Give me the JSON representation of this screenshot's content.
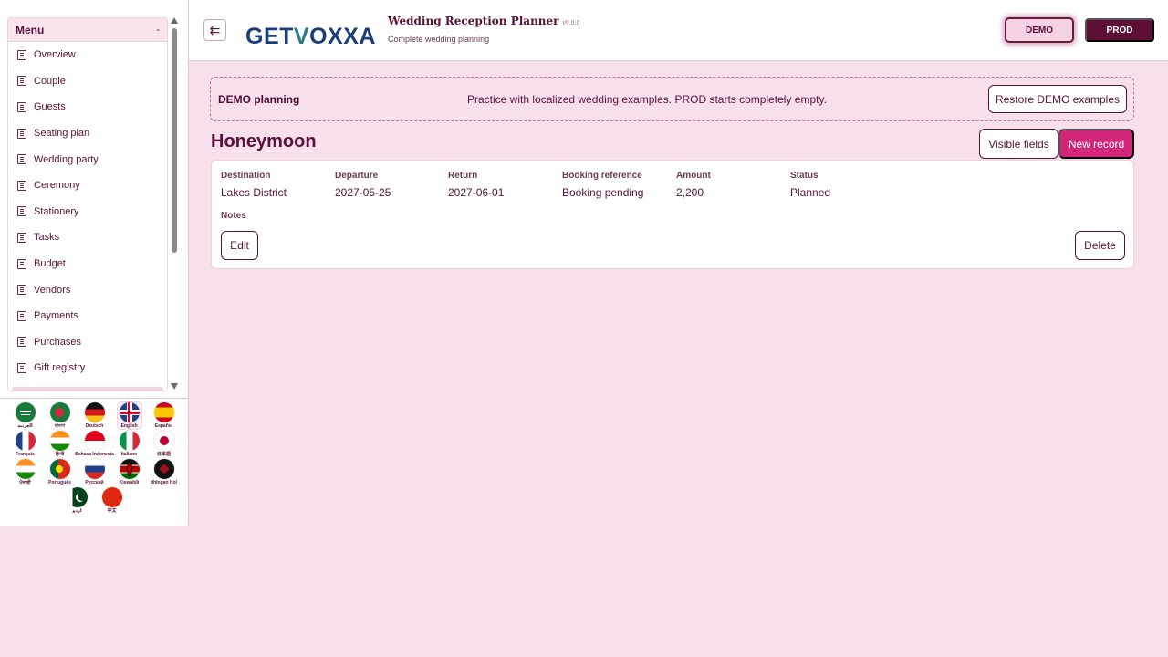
{
  "sidebar": {
    "menu_title": "Menu",
    "collapse_glyph": "-",
    "items": [
      {
        "label": "Overview"
      },
      {
        "label": "Couple"
      },
      {
        "label": "Guests"
      },
      {
        "label": "Seating plan"
      },
      {
        "label": "Wedding party"
      },
      {
        "label": "Ceremony"
      },
      {
        "label": "Stationery"
      },
      {
        "label": "Tasks"
      },
      {
        "label": "Budget"
      },
      {
        "label": "Vendors"
      },
      {
        "label": "Payments"
      },
      {
        "label": "Purchases"
      },
      {
        "label": "Gift registry"
      }
    ],
    "languages": [
      {
        "label": "العربية"
      },
      {
        "label": "বাংলা"
      },
      {
        "label": "Deutsch"
      },
      {
        "label": "English",
        "selected": true
      },
      {
        "label": "Español"
      },
      {
        "label": "Français"
      },
      {
        "label": "हिन्दी"
      },
      {
        "label": "Bahasa Indonesia"
      },
      {
        "label": "Italiano"
      },
      {
        "label": "日本語"
      },
      {
        "label": "ਪੰਜਾਬੀ"
      },
      {
        "label": "Português"
      },
      {
        "label": "Русский"
      },
      {
        "label": "Kiswahili"
      },
      {
        "label": "tlhIngan Hol"
      },
      {
        "label": "اردو"
      },
      {
        "label": "中文"
      }
    ]
  },
  "header": {
    "toggle_glyph": "⇇",
    "logo_get": "GET",
    "logo_v": "V",
    "logo_rest": "OXXA",
    "title": "Wedding Reception Planner",
    "version": "v9.0.0",
    "subtitle": "Complete wedding planning",
    "demo_label": "DEMO",
    "prod_label": "PROD"
  },
  "banner": {
    "title": "DEMO planning",
    "text": "Practice with localized wedding examples. PROD starts completely empty.",
    "restore_label": "Restore DEMO examples"
  },
  "section": {
    "title": "Honeymoon",
    "visible_fields_label": "Visible fields",
    "new_record_label": "New record"
  },
  "record": {
    "fields": [
      {
        "label": "Destination",
        "value": "Lakes District"
      },
      {
        "label": "Departure",
        "value": "2027-05-25"
      },
      {
        "label": "Return",
        "value": "2027-06-01"
      },
      {
        "label": "Booking reference",
        "value": "Booking pending"
      },
      {
        "label": "Amount",
        "value": "2,200"
      },
      {
        "label": "Status",
        "value": "Planned"
      }
    ],
    "notes_label": "Notes",
    "edit_label": "Edit",
    "delete_label": "Delete"
  }
}
